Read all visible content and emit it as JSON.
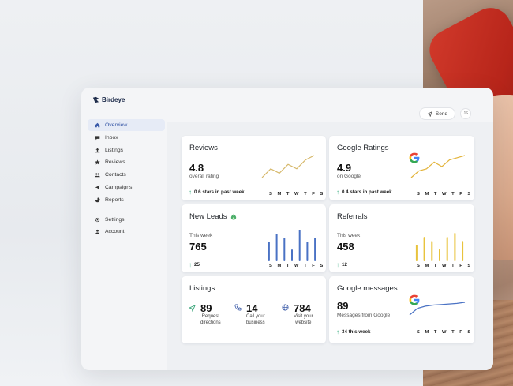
{
  "brand": {
    "name": "Birdeye"
  },
  "topbar": {
    "send_label": "Send",
    "avatar_initials": "JS"
  },
  "sidebar": {
    "items": [
      {
        "label": "Overview",
        "icon": "home-icon",
        "active": true
      },
      {
        "label": "Inbox",
        "icon": "chat-bubble-icon"
      },
      {
        "label": "Listings",
        "icon": "upload-icon"
      },
      {
        "label": "Reviews",
        "icon": "star-icon"
      },
      {
        "label": "Contacts",
        "icon": "people-icon"
      },
      {
        "label": "Campaigns",
        "icon": "paper-plane-icon"
      },
      {
        "label": "Reports",
        "icon": "pie-chart-icon"
      }
    ],
    "bottom_items": [
      {
        "label": "Settings",
        "icon": "gear-icon"
      },
      {
        "label": "Account",
        "icon": "person-icon"
      }
    ]
  },
  "cards": {
    "reviews": {
      "title": "Reviews",
      "value": "4.8",
      "sub": "overall rating",
      "trend": "0.6 stars in past week",
      "line": [
        2,
        4,
        3,
        5,
        4,
        6,
        7
      ],
      "line_color": "#d6b86a"
    },
    "google_ratings": {
      "title": "Google Ratings",
      "value": "4.9",
      "sub": "on Google",
      "trend": "0.4 stars in past week",
      "line": [
        2,
        3.5,
        4,
        5.5,
        4.5,
        6,
        6.5,
        7
      ],
      "line_color": "#e3b43b"
    },
    "new_leads": {
      "title": "New Leads",
      "sub": "This week",
      "value": "765",
      "trend": "25",
      "bars": [
        5,
        7,
        6,
        3,
        8,
        5,
        6
      ],
      "bar_color": "#4a72c4"
    },
    "referrals": {
      "title": "Referrals",
      "sub": "This week",
      "value": "458",
      "trend": "12",
      "bars": [
        4,
        6,
        5,
        3,
        6,
        7,
        5
      ],
      "bar_color": "#e8c33d"
    },
    "listings": {
      "title": "Listings",
      "stats": [
        {
          "icon": "navigation-arrow-icon",
          "value": "89",
          "label_1": "Request",
          "label_2": "directions"
        },
        {
          "icon": "phone-icon",
          "value": "14",
          "label_1": "Call your",
          "label_2": "business"
        },
        {
          "icon": "globe-icon",
          "value": "784",
          "label_1": "Visit your",
          "label_2": "website"
        }
      ]
    },
    "google_messages": {
      "title": "Google messages",
      "value": "89",
      "sub": "Messages from Google",
      "trend": "34 this week",
      "line": [
        2,
        3.2,
        3.6,
        3.8,
        3.9,
        4.0,
        4.1,
        4.3
      ],
      "line_color": "#4a72c4"
    }
  },
  "days": [
    "S",
    "M",
    "T",
    "W",
    "T",
    "F",
    "S"
  ],
  "colors": {
    "accent": "#3a5aa8",
    "up_arrow": "#47b389"
  }
}
